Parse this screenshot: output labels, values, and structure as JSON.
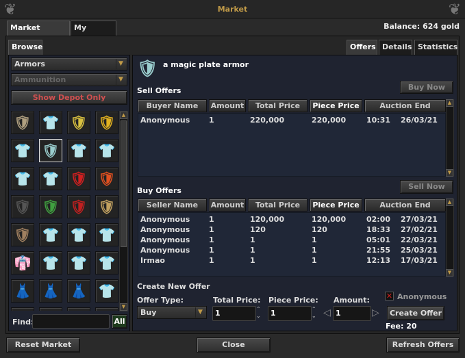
{
  "window": {
    "title": "Market",
    "balance": "Balance: 624 gold"
  },
  "tabs": [
    {
      "label": "Market Offers",
      "active": true
    },
    {
      "label": "My Offers",
      "active": false
    }
  ],
  "browse": {
    "tab": "Browse",
    "category": "Armors",
    "subcategory": "Ammunition",
    "depot_button": "Show Depot Only",
    "find_label": "Find:",
    "find_value": "",
    "all_button": "All"
  },
  "items": [
    {
      "name": "chain-armor-icon",
      "glyph": "🛡",
      "color": "#b0a080"
    },
    {
      "name": "chain-armor-blue-icon",
      "glyph": "👕",
      "color": "#9ab"
    },
    {
      "name": "golden-armor-icon",
      "glyph": "🛡",
      "color": "#d8c040"
    },
    {
      "name": "golden-armor-2-icon",
      "glyph": "🛡",
      "color": "#e0b020"
    },
    {
      "name": "leather-armor-icon",
      "glyph": "👕",
      "color": "#a0602a"
    },
    {
      "name": "magic-plate-armor-icon",
      "glyph": "🛡",
      "color": "#9cc",
      "selected": true
    },
    {
      "name": "orange-armor-icon",
      "glyph": "👕",
      "color": "#c07020"
    },
    {
      "name": "plate-armor-icon",
      "glyph": "👕",
      "color": "#ddd"
    },
    {
      "name": "chain-mail-icon",
      "glyph": "👕",
      "color": "#c0b090"
    },
    {
      "name": "red-robe-icon",
      "glyph": "👕",
      "color": "#c03030"
    },
    {
      "name": "red-armor-icon",
      "glyph": "🛡",
      "color": "#d02020"
    },
    {
      "name": "flame-armor-icon",
      "glyph": "🛡",
      "color": "#e05020"
    },
    {
      "name": "dark-armor-icon",
      "glyph": "🛡",
      "color": "#555"
    },
    {
      "name": "green-armor-icon",
      "glyph": "🛡",
      "color": "#40a040"
    },
    {
      "name": "crimson-armor-icon",
      "glyph": "🛡",
      "color": "#c02020"
    },
    {
      "name": "gold-plate-icon",
      "glyph": "🛡",
      "color": "#c0a060"
    },
    {
      "name": "bronze-armor-icon",
      "glyph": "🛡",
      "color": "#a08060"
    },
    {
      "name": "brown-coat-icon",
      "glyph": "👕",
      "color": "#b07040"
    },
    {
      "name": "blue-coat-icon",
      "glyph": "👕",
      "color": "#4060a0"
    },
    {
      "name": "green-tunic-icon",
      "glyph": "👕",
      "color": "#40a040"
    },
    {
      "name": "red-kimono-icon",
      "glyph": "👘",
      "color": "#c02020"
    },
    {
      "name": "blue-robe-icon",
      "glyph": "👕",
      "color": "#2040a0"
    },
    {
      "name": "red-cape-icon",
      "glyph": "👕",
      "color": "#a03040"
    },
    {
      "name": "blue-cape-icon",
      "glyph": "👕",
      "color": "#3050d0"
    },
    {
      "name": "green-dress-icon",
      "glyph": "👗",
      "color": "#a0c060"
    },
    {
      "name": "white-dress-icon",
      "glyph": "👗",
      "color": "#d0d0f0"
    },
    {
      "name": "green-gown-icon",
      "glyph": "👗",
      "color": "#308030"
    },
    {
      "name": "fire-cape-icon",
      "glyph": "👕",
      "color": "#d03010"
    }
  ],
  "right_tabs": [
    {
      "label": "Offers",
      "active": true
    },
    {
      "label": "Details",
      "active": false
    },
    {
      "label": "Statistics",
      "active": false
    }
  ],
  "selected_item": {
    "name": "a magic plate armor"
  },
  "sell_offers": {
    "title": "Sell Offers",
    "button": "Buy Now",
    "columns": [
      "Buyer Name",
      "Amount",
      "Total Price",
      "Piece Price",
      "Auction End"
    ],
    "sorted_column": "Piece Price",
    "rows": [
      [
        "Anonymous",
        "1",
        "220,000",
        "220,000",
        "10:31",
        "26/03/21"
      ]
    ]
  },
  "buy_offers": {
    "title": "Buy Offers",
    "button": "Sell Now",
    "columns": [
      "Seller Name",
      "Amount",
      "Total Price",
      "Piece Price",
      "Auction End"
    ],
    "sorted_column": "Piece Price",
    "rows": [
      [
        "Anonymous",
        "1",
        "120,000",
        "120,000",
        "02:00",
        "27/03/21"
      ],
      [
        "Anonymous",
        "1",
        "120",
        "120",
        "18:33",
        "27/02/21"
      ],
      [
        "Anonymous",
        "1",
        "1",
        "1",
        "05:01",
        "22/03/21"
      ],
      [
        "Anonymous",
        "1",
        "1",
        "1",
        "21:55",
        "25/03/21"
      ],
      [
        "Irmao",
        "1",
        "1",
        "1",
        "12:13",
        "17/03/21"
      ]
    ]
  },
  "create_offer": {
    "title": "Create New Offer",
    "offer_type_label": "Offer Type:",
    "offer_type": "Buy",
    "total_price_label": "Total Price:",
    "total_price": "1",
    "piece_price_label": "Piece Price:",
    "piece_price": "1",
    "amount_label": "Amount:",
    "amount": "1",
    "anonymous_label": "Anonymous",
    "anonymous_checked": true,
    "create_button": "Create Offer",
    "fee": "Fee: 20"
  },
  "footer": {
    "reset": "Reset Market",
    "close": "Close",
    "refresh": "Refresh Offers"
  },
  "colors": {
    "title": "#c09a48",
    "depot": "#d05050",
    "panel": "#1f2330"
  }
}
